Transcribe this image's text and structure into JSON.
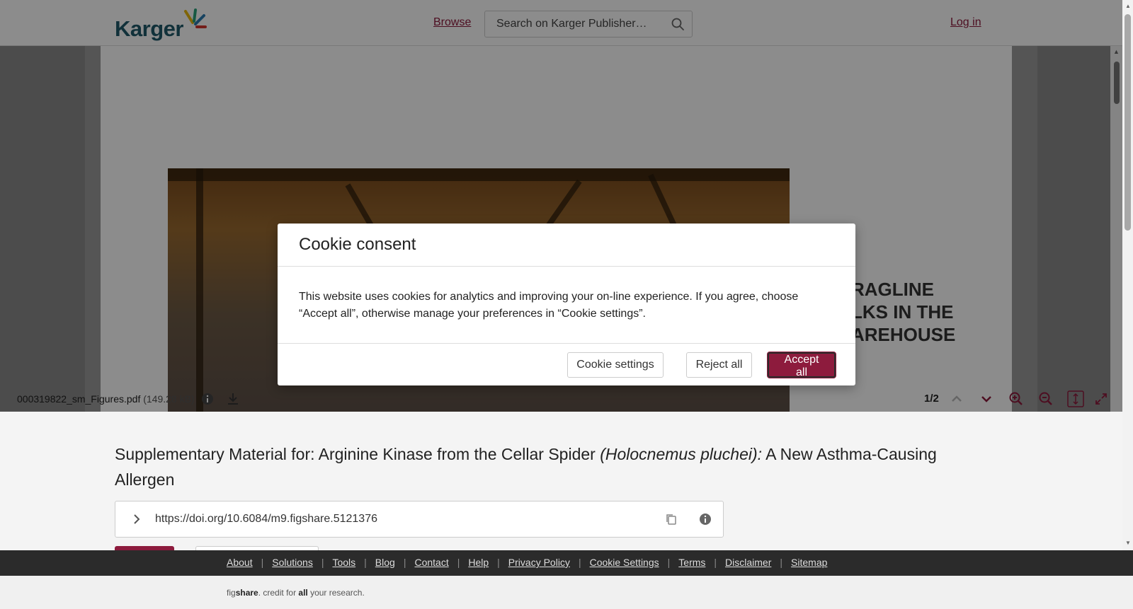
{
  "header": {
    "logo_text": "Karger",
    "browse_label": "Browse",
    "search_placeholder": "Search on Karger Publisher…",
    "login_label": "Log in"
  },
  "pdf": {
    "visible_heading_lines": [
      "RAGLINE",
      "LKS IN THE",
      "AREHOUSE"
    ]
  },
  "toolbar": {
    "file_name": "000319822_sm_Figures.pdf",
    "file_size": "(149.28 kB)",
    "page_indicator": "1/2"
  },
  "article": {
    "title_before": "Supplementary Material for: Arginine Kinase from the Cellar Spider ",
    "title_italic": "(Holocnemus pluchei):",
    "title_after": " A New Asthma-Causing Allergen",
    "doi": "https://doi.org/10.6084/m9.figshare.5121376"
  },
  "modal": {
    "title": "Cookie consent",
    "body": "This website uses cookies for analytics and improving your on-line experience. If you agree, choose “Accept all”, otherwise manage your preferences in “Cookie settings”.",
    "settings_label": "Cookie settings",
    "reject_label": "Reject all",
    "accept_label": "Accept all"
  },
  "footer": {
    "links": [
      "About",
      "Solutions",
      "Tools",
      "Blog",
      "Contact",
      "Help",
      "Privacy Policy",
      "Cookie Settings",
      "Terms",
      "Disclaimer",
      "Sitemap"
    ],
    "credit_fig": "fig",
    "credit_share": "share",
    "credit_mid": ". credit for ",
    "credit_all": "all",
    "credit_end": " your research."
  },
  "colors": {
    "brand": "#8d1b3d",
    "logo": "#1f5a6b"
  }
}
